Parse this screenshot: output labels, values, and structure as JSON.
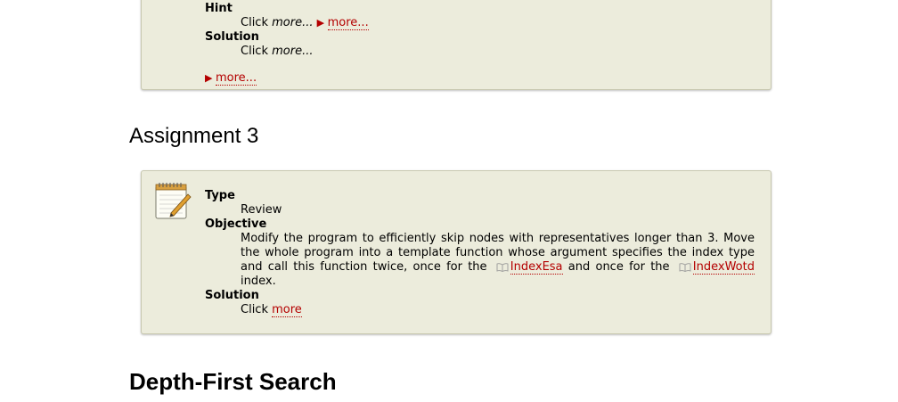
{
  "box1": {
    "hint_term": "Hint",
    "hint_click": "Click",
    "hint_more_em": "more...",
    "hint_more_link": "more...",
    "solution_term": "Solution",
    "solution_click": "Click",
    "solution_more_em": "more...",
    "bottom_more_link": "more..."
  },
  "heading_assignment3": "Assignment 3",
  "box2": {
    "icon": "notepad-pencil-icon",
    "type_term": "Type",
    "type_value": "Review",
    "objective_term": "Objective",
    "objective_text_1": "Modify the program to efficiently skip nodes with representatives longer than 3. Move the whole program into a template function whose argument specifies the index type and call this function twice, once for the",
    "objective_link_1": "IndexEsa",
    "objective_text_2": "and once for the",
    "objective_link_2": "IndexWotd",
    "objective_text_3": "index.",
    "solution_term": "Solution",
    "solution_click": "Click",
    "solution_link": "more"
  },
  "heading_dfs": "Depth-First Search",
  "colors": {
    "link": "#b40000",
    "box_bg": "#ececdc"
  }
}
